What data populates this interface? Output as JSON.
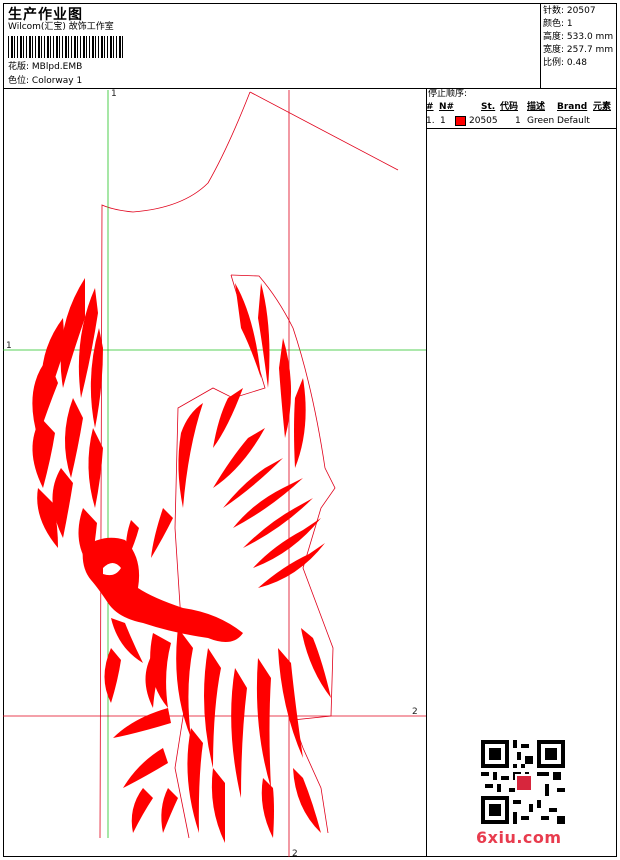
{
  "header": {
    "title": "生产作业图",
    "company": "Wilcom(汇宝) 故饰工作室",
    "pattern_label": "花版:",
    "pattern_value": "MBlpd.EMB",
    "colorway_label": "色位:",
    "colorway_value": "Colorway 1"
  },
  "stats": [
    {
      "label": "针数:",
      "value": "20507"
    },
    {
      "label": "颜色:",
      "value": "1"
    },
    {
      "label": "高度:",
      "value": "533.0 mm"
    },
    {
      "label": "宽度:",
      "value": "257.7 mm"
    },
    {
      "label": "比例:",
      "value": "0.48"
    }
  ],
  "stop_sequence": {
    "title": "停止顺序:",
    "columns": [
      "#",
      "N#",
      "St.",
      "代码",
      "描述",
      "Brand",
      "元素"
    ],
    "rows": [
      {
        "num": "1.",
        "n": "1",
        "color": "#ff0000",
        "stitches": "20505",
        "code": "1",
        "description": "Green",
        "brand": "Default"
      }
    ]
  },
  "guides": {
    "v1": "1",
    "h1": "1",
    "h2": "2",
    "v2": "2"
  },
  "design": {
    "thread_color": "#ff0000",
    "guide_v_color": "#22c322",
    "guide_h1_color": "#22c322",
    "guide_red_color": "#e0001a"
  },
  "watermark": {
    "text": "6xiu.com"
  }
}
